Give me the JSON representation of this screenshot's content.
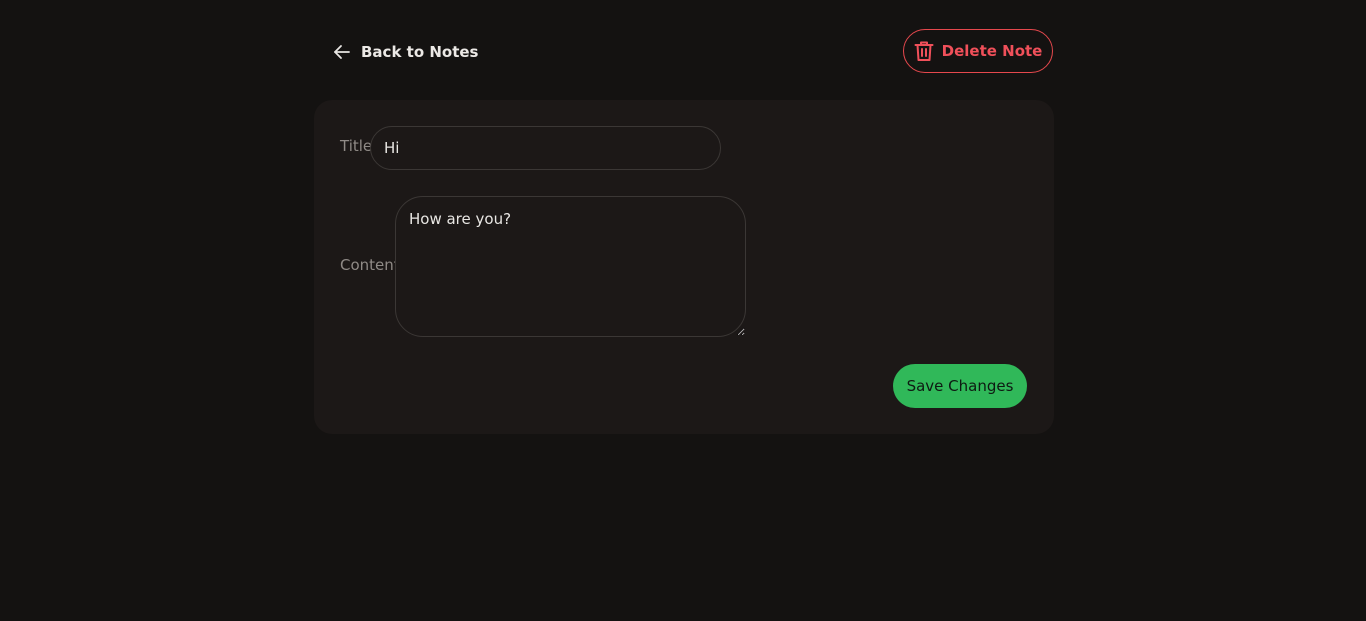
{
  "header": {
    "back_label": "Back to Notes",
    "back_icon": "arrow-left-icon",
    "delete_label": "Delete Note",
    "delete_icon": "trash-icon"
  },
  "form": {
    "title_label": "Title",
    "title_value": "Hi",
    "content_label": "Content",
    "content_value": "How are you?",
    "save_label": "Save Changes"
  },
  "colors": {
    "background": "#141211",
    "card": "#1c1817",
    "danger": "#e5484d",
    "success": "#30b859"
  }
}
